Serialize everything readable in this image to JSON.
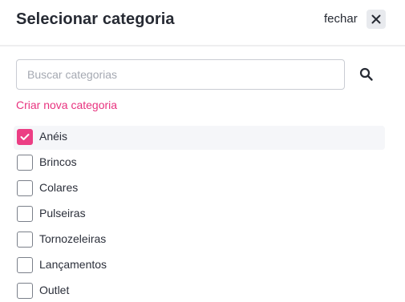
{
  "header": {
    "title": "Selecionar categoria",
    "close_label": "fechar"
  },
  "search": {
    "value": "",
    "placeholder": "Buscar categorias"
  },
  "create_link": "Criar nova categoria",
  "categories": [
    {
      "label": "Anéis",
      "checked": true
    },
    {
      "label": "Brincos",
      "checked": false
    },
    {
      "label": "Colares",
      "checked": false
    },
    {
      "label": "Pulseiras",
      "checked": false
    },
    {
      "label": "Tornozeleiras",
      "checked": false
    },
    {
      "label": "Lançamentos",
      "checked": false
    },
    {
      "label": "Outlet",
      "checked": false
    }
  ],
  "icons": {
    "close": "close-icon",
    "search": "search-icon",
    "check": "check-icon"
  },
  "colors": {
    "accent": "#ec3e84",
    "link": "#e8337f",
    "selected_row_bg": "#f5f6f9",
    "close_button_bg": "#e8eaee"
  }
}
